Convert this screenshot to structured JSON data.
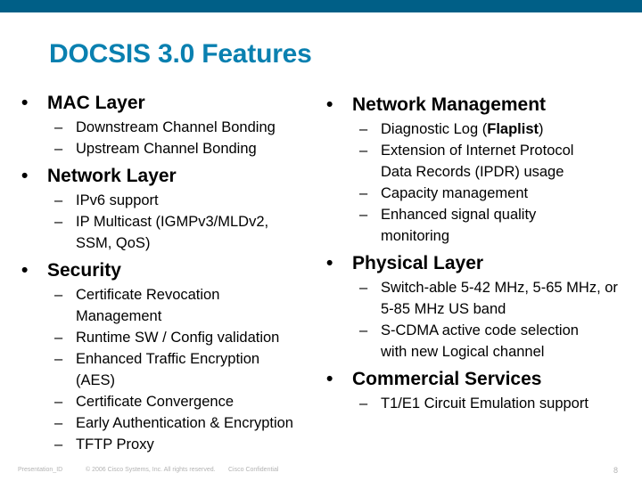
{
  "slide": {
    "title": "DOCSIS 3.0 Features",
    "bullet_glyph": "•",
    "dash_glyph": "–"
  },
  "left_column": [
    {
      "heading": "MAC Layer",
      "items": [
        "Downstream Channel Bonding",
        "Upstream Channel Bonding"
      ]
    },
    {
      "heading": "Network Layer",
      "items": [
        "IPv6 support",
        "IP Multicast (IGMPv3/MLDv2, SSM, QoS)"
      ]
    },
    {
      "heading": "Security",
      "items": [
        "Certificate Revocation Management",
        "Runtime SW / Config validation",
        "Enhanced Traffic Encryption (AES)",
        "Certificate Convergence",
        "Early Authentication & Encryption",
        "TFTP Proxy"
      ]
    }
  ],
  "right_column": [
    {
      "heading": "Network Management",
      "items": [
        "Diagnostic Log (Flaplist)",
        "Extension of Internet Protocol Data Records (IPDR) usage",
        "Capacity management",
        "Enhanced signal quality monitoring"
      ]
    },
    {
      "heading": "Physical Layer",
      "items": [
        "Switch-able 5-42 MHz, 5-65 MHz, or 5-85 MHz US band",
        "S-CDMA active code selection with new Logical channel"
      ]
    },
    {
      "heading": "Commercial Services",
      "items": [
        "T1/E1 Circuit Emulation support"
      ]
    }
  ],
  "footer": {
    "presentation_id": "Presentation_ID",
    "copyright": "© 2006 Cisco Systems, Inc. All rights reserved.",
    "confidential": "Cisco Confidential",
    "page_number": "8"
  },
  "colors": {
    "top_bar": "#005f87",
    "title": "#0a80b0",
    "body_text": "#000000",
    "footer_text": "#b3b3b3"
  }
}
